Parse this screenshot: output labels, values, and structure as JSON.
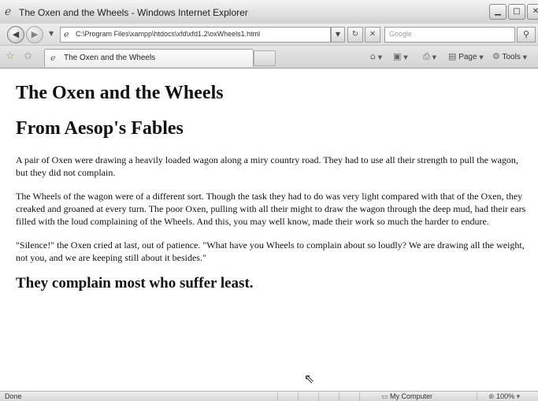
{
  "window": {
    "title": "The Oxen and the Wheels - Windows Internet Explorer"
  },
  "address_bar": {
    "url": "C:\\Program Files\\xampp\\htdocs\\xfd\\xfd1.2\\oxWheels1.html",
    "search_placeholder": "Google"
  },
  "tabs": [
    {
      "label": "The Oxen and the Wheels",
      "active": true
    }
  ],
  "command_bar": {
    "page_label": "Page",
    "tools_label": "Tools"
  },
  "page": {
    "heading": "The Oxen and the Wheels",
    "subheading": "From Aesop's Fables",
    "paragraphs": [
      "A pair of Oxen were drawing a heavily loaded wagon along a miry country road. They had to use all their strength to pull the wagon, but they did not complain.",
      "The Wheels of the wagon were of a different sort. Though the task they had to do was very light compared with that of the Oxen, they creaked and groaned at every turn. The poor Oxen, pulling with all their might to draw the wagon through the deep mud, had their ears filled with the loud complaining of the Wheels. And this, you may well know, made their work so much the harder to endure.",
      "\"Silence!\" the Oxen cried at last, out of patience. \"What have you Wheels to complain about so loudly? We are drawing all the weight, not you, and we are keeping still about it besides.\""
    ],
    "moral": "They complain most who suffer least."
  },
  "status_bar": {
    "status": "Done",
    "zone": "My Computer",
    "zoom": "100%"
  }
}
